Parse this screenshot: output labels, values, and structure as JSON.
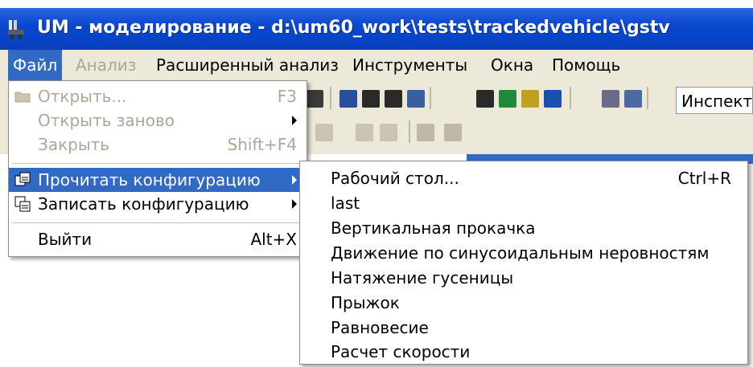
{
  "window": {
    "title": "UM - моделирование - d:\\um60_work\\tests\\trackedvehicle\\gstv"
  },
  "menubar": {
    "items": [
      {
        "label": "Файл"
      },
      {
        "label": "Анализ"
      },
      {
        "label": "Расширенный анализ"
      },
      {
        "label": "Инструменты"
      },
      {
        "label": "Окна"
      },
      {
        "label": "Помощь"
      }
    ]
  },
  "toolbar": {
    "inspector_label": "Инспект"
  },
  "file_menu": {
    "items": [
      {
        "label": "Открыть...",
        "shortcut": "F3"
      },
      {
        "label": "Открыть заново"
      },
      {
        "label": "Закрыть",
        "shortcut": "Shift+F4"
      },
      {
        "label": "Прочитать конфигурацию"
      },
      {
        "label": "Записать конфигурацию"
      },
      {
        "label": "Выйти",
        "shortcut": "Alt+X"
      }
    ]
  },
  "submenu": {
    "items": [
      {
        "label": "Рабочий стол...",
        "shortcut": "Ctrl+R"
      },
      {
        "label": "last"
      },
      {
        "label": "Вертикальная прокачка"
      },
      {
        "label": "Движение по синусоидальным неровностям"
      },
      {
        "label": "Натяжение гусеницы"
      },
      {
        "label": "Прыжок"
      },
      {
        "label": "Равновесие"
      },
      {
        "label": "Расчет скорости"
      }
    ]
  },
  "colors": {
    "titlebar": "#0a48cf",
    "highlight": "#316ac5",
    "menubar_bg": "#ece9d8",
    "disabled_text": "#aca899"
  }
}
